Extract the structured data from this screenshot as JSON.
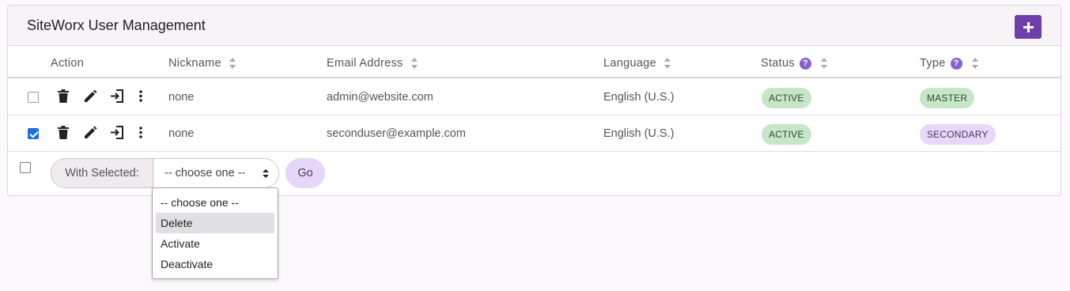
{
  "header": {
    "title": "SiteWorx User Management",
    "add_icon": "plus-icon"
  },
  "columns": {
    "action": "Action",
    "nickname": "Nickname",
    "email": "Email Address",
    "language": "Language",
    "status": "Status",
    "type": "Type",
    "help_glyph": "?"
  },
  "rows": [
    {
      "checked": false,
      "nickname": "none",
      "email": "admin@website.com",
      "language": "English (U.S.)",
      "status": "ACTIVE",
      "type": "MASTER"
    },
    {
      "checked": true,
      "nickname": "none",
      "email": "seconduser@example.com",
      "language": "English (U.S.)",
      "status": "ACTIVE",
      "type": "SECONDARY"
    }
  ],
  "bulk": {
    "label": "With Selected:",
    "selected": "-- choose one --",
    "go": "Go",
    "options": [
      "-- choose one --",
      "Delete",
      "Activate",
      "Deactivate"
    ],
    "highlighted_option": "Delete"
  },
  "colors": {
    "accent": "#6e3fa8",
    "help": "#8a5fd0",
    "status_active_bg": "#c7e6c7",
    "type_secondary_bg": "#e8d8f7",
    "checkbox_checked": "#1f6fde"
  }
}
